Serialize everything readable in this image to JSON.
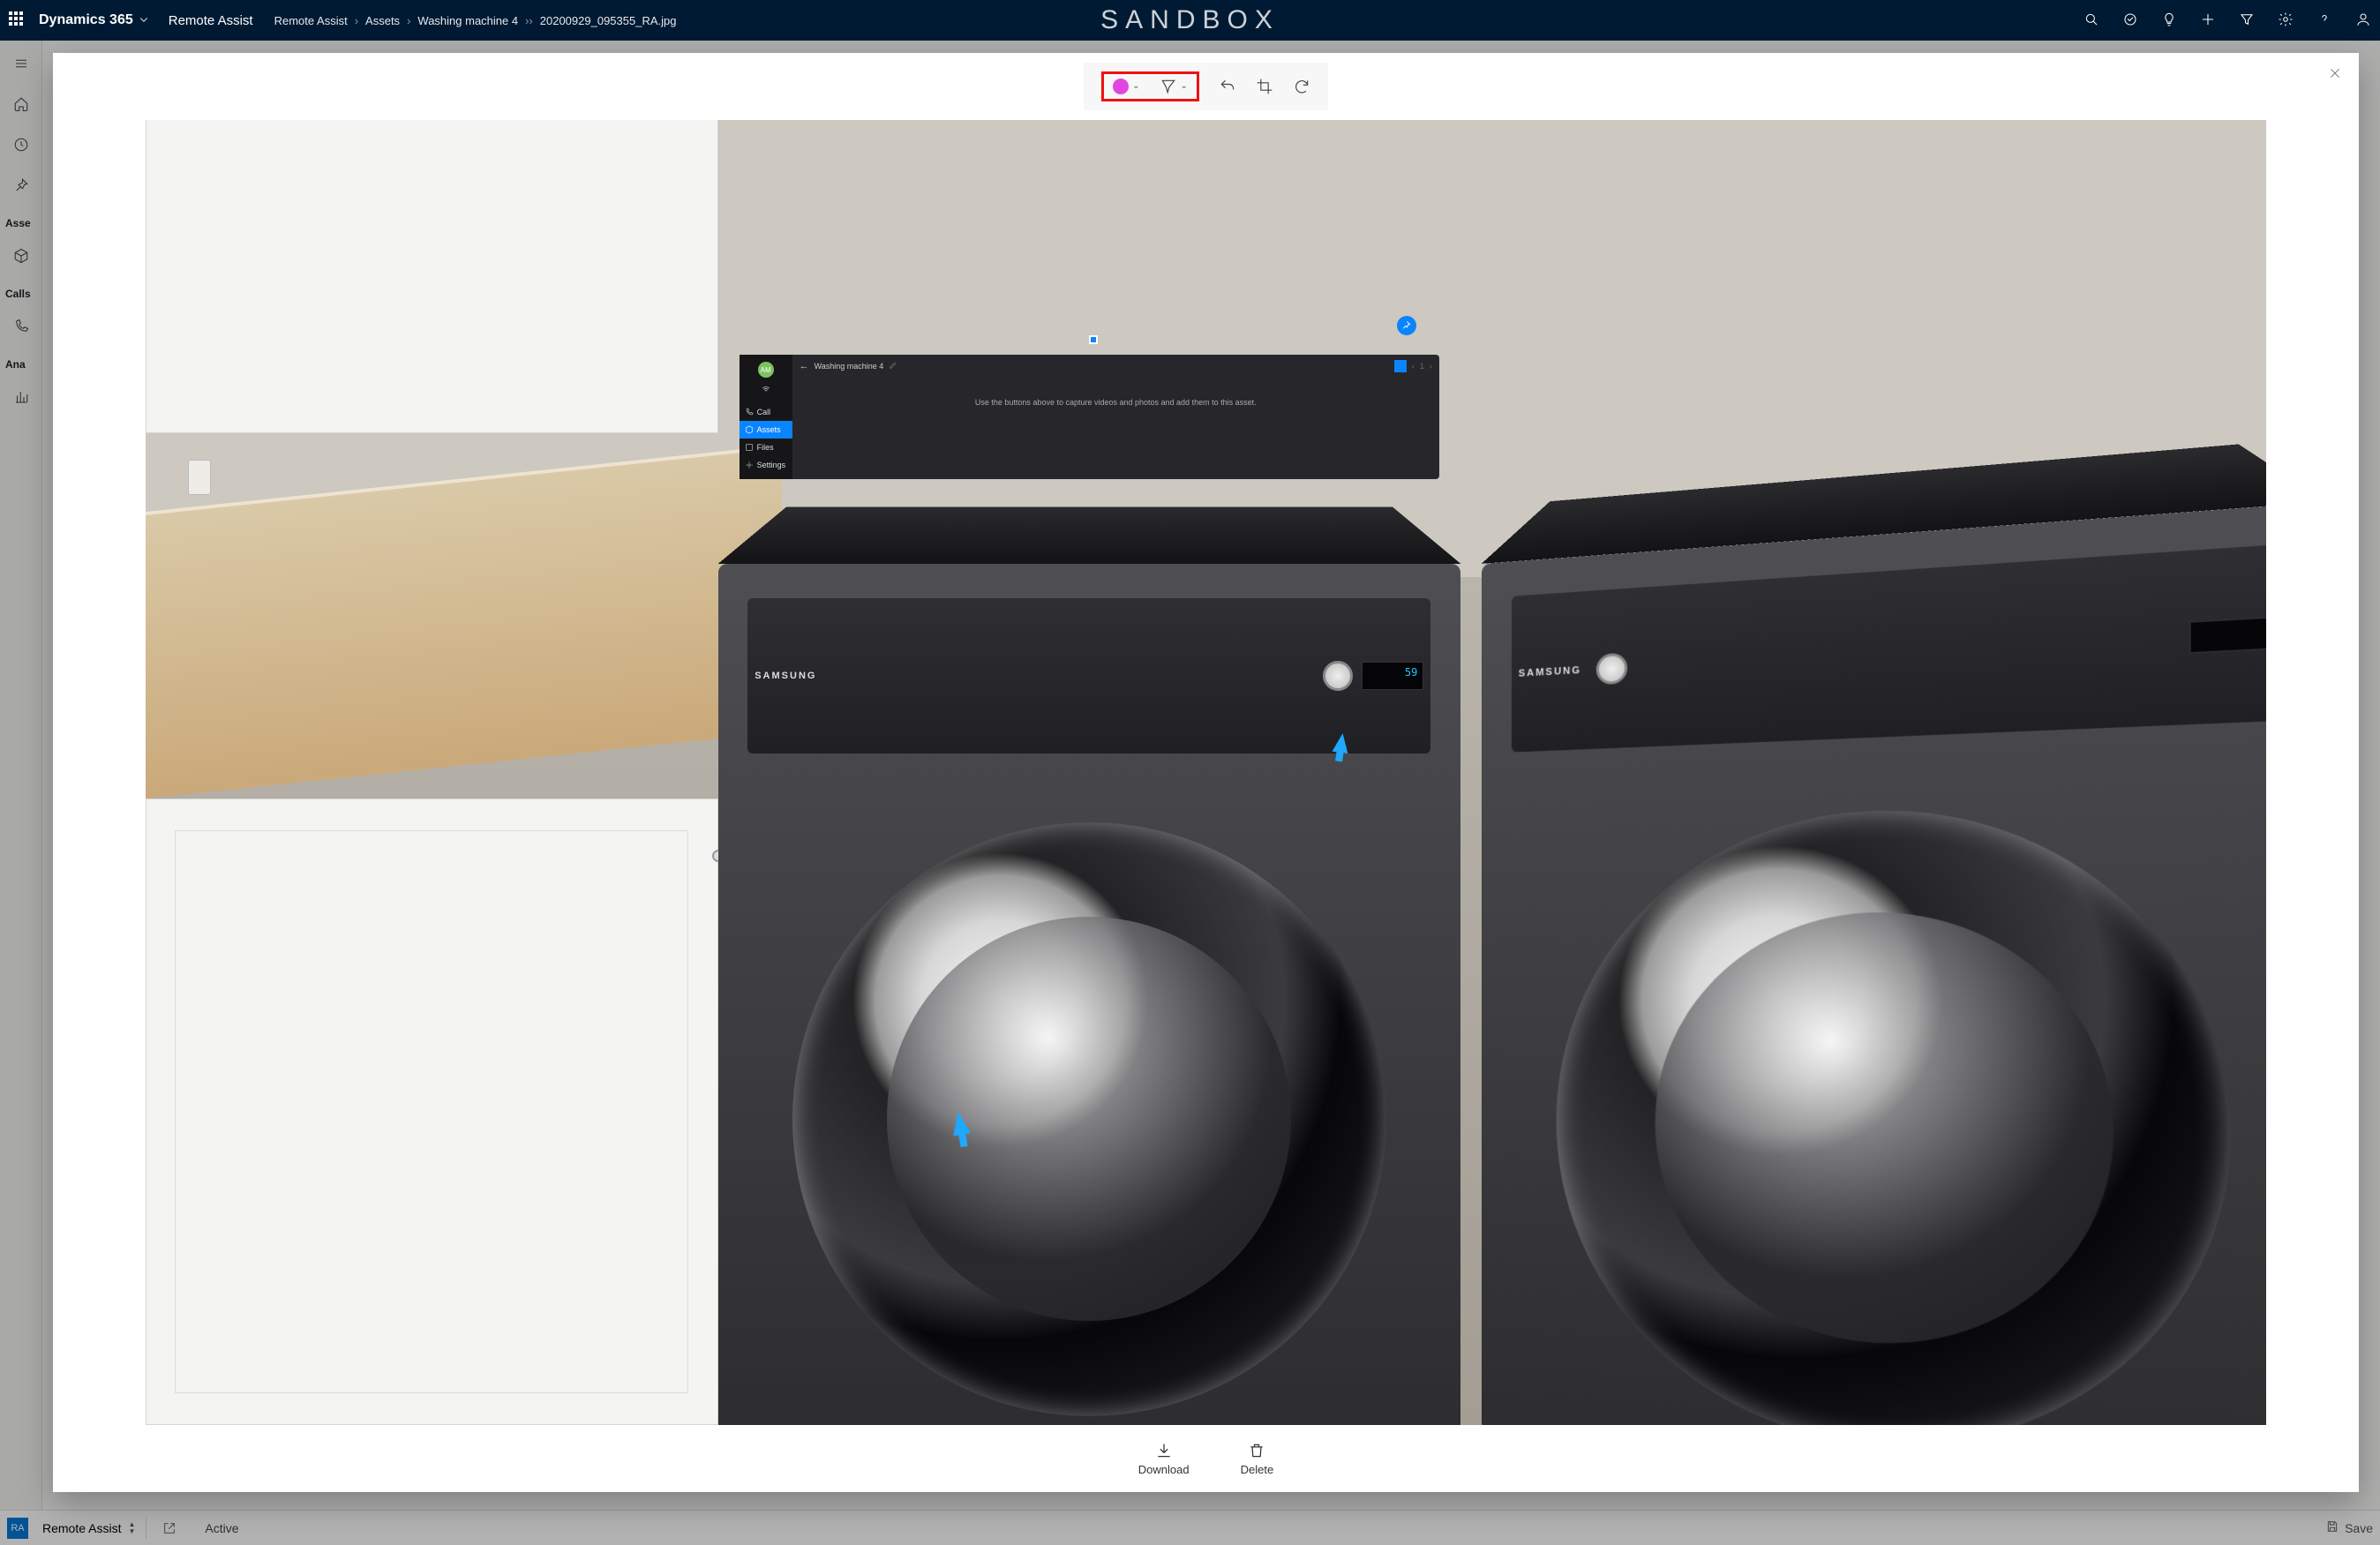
{
  "topbar": {
    "app_name": "Dynamics 365",
    "area_name": "Remote Assist",
    "watermark": "SANDBOX",
    "breadcrumb": [
      "Remote Assist",
      "Assets",
      "Washing machine 4"
    ],
    "breadcrumb_current": "20200929_095355_RA.jpg"
  },
  "top_icons": {
    "search": "search-icon",
    "target": "target-icon",
    "idea": "lightbulb-icon",
    "add": "plus-icon",
    "filter": "filter-icon",
    "settings": "gear-icon",
    "help": "help-icon",
    "account": "account-icon"
  },
  "rail": {
    "groups": [
      "Asse",
      "Calls",
      "Ana"
    ]
  },
  "statusbar": {
    "avatar_initials": "RA",
    "area_picker": "Remote Assist",
    "form_status": "Active",
    "save_label": "Save"
  },
  "modal": {
    "toolbar": {
      "color": "#e246e2",
      "tools": {
        "color_label": "ink-color-picker",
        "ink_label": "ink-tool-picker",
        "undo_label": "undo",
        "crop_label": "crop",
        "rotate_label": "rotate"
      }
    },
    "actions": {
      "download": "Download",
      "delete": "Delete"
    },
    "photo": {
      "washer_brand": "SAMSUNG",
      "dryer_brand": "SAMSUNG",
      "display_value": "59",
      "holo": {
        "title": "Washing machine 4",
        "hint": "Use the buttons above to capture videos and photos and add them to this asset.",
        "avatar": "AM",
        "pager": "1",
        "items": {
          "call": "Call",
          "assets": "Assets",
          "files": "Files",
          "settings": "Settings"
        }
      }
    }
  }
}
